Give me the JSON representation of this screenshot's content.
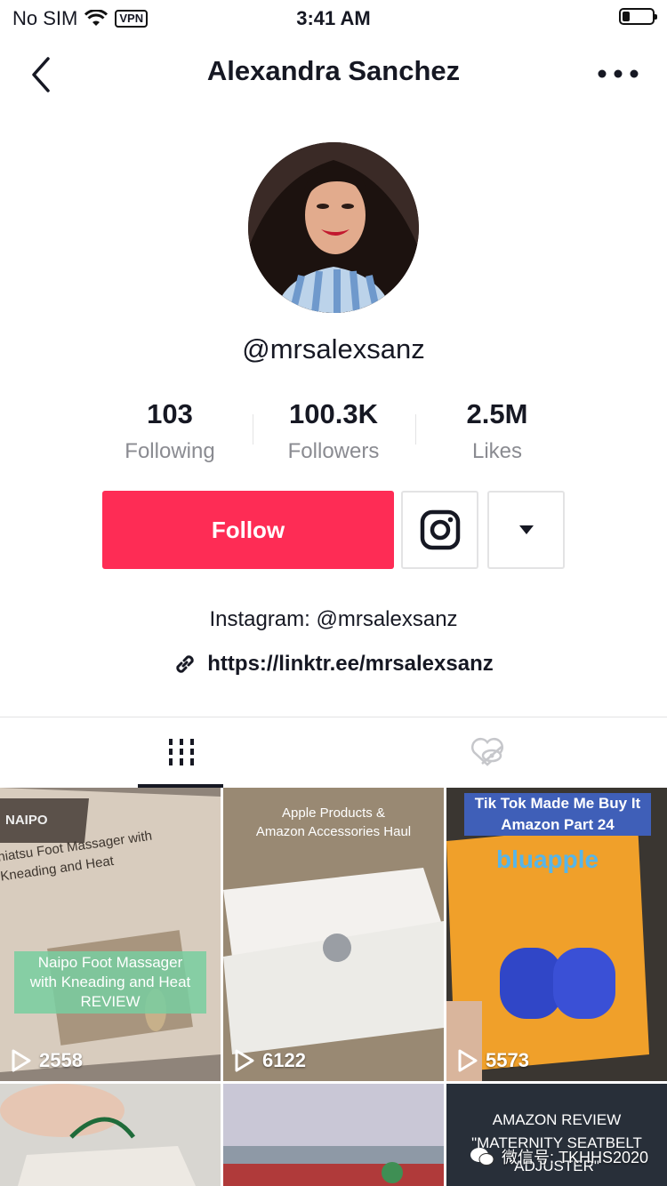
{
  "status_bar": {
    "carrier": "No SIM",
    "vpn": "VPN",
    "time": "3:41 AM"
  },
  "header": {
    "title": "Alexandra Sanchez"
  },
  "profile": {
    "username": "@mrsalexsanz",
    "stats": [
      {
        "value": "103",
        "label": "Following"
      },
      {
        "value": "100.3K",
        "label": "Followers"
      },
      {
        "value": "2.5M",
        "label": "Likes"
      }
    ],
    "follow_label": "Follow",
    "bio": "Instagram: @mrsalexsanz",
    "link": "https://linktr.ee/mrsalexsanz"
  },
  "videos": [
    {
      "brand": "NAIPO",
      "box_text": "hiatsu Foot Massager with\nKneading and Heat",
      "caption": "Naipo Foot Massager\nwith Kneading and Heat\nREVIEW",
      "views": "2558"
    },
    {
      "caption": "Apple Products &\nAmazon Accessories Haul",
      "views": "6122"
    },
    {
      "caption": "Tik Tok Made Me Buy It\nAmazon Part 24",
      "brand": "bluapple",
      "views": "5573"
    },
    {
      "views": ""
    },
    {
      "views": ""
    },
    {
      "caption": "AMAZON REVIEW\n\"MATERNITY SEATBELT ADJUSTER\"",
      "views": ""
    }
  ],
  "watermark": "微信号: TKHHS2020",
  "colors": {
    "accent": "#fe2c55",
    "text": "#161823",
    "muted": "#8a8b91"
  }
}
